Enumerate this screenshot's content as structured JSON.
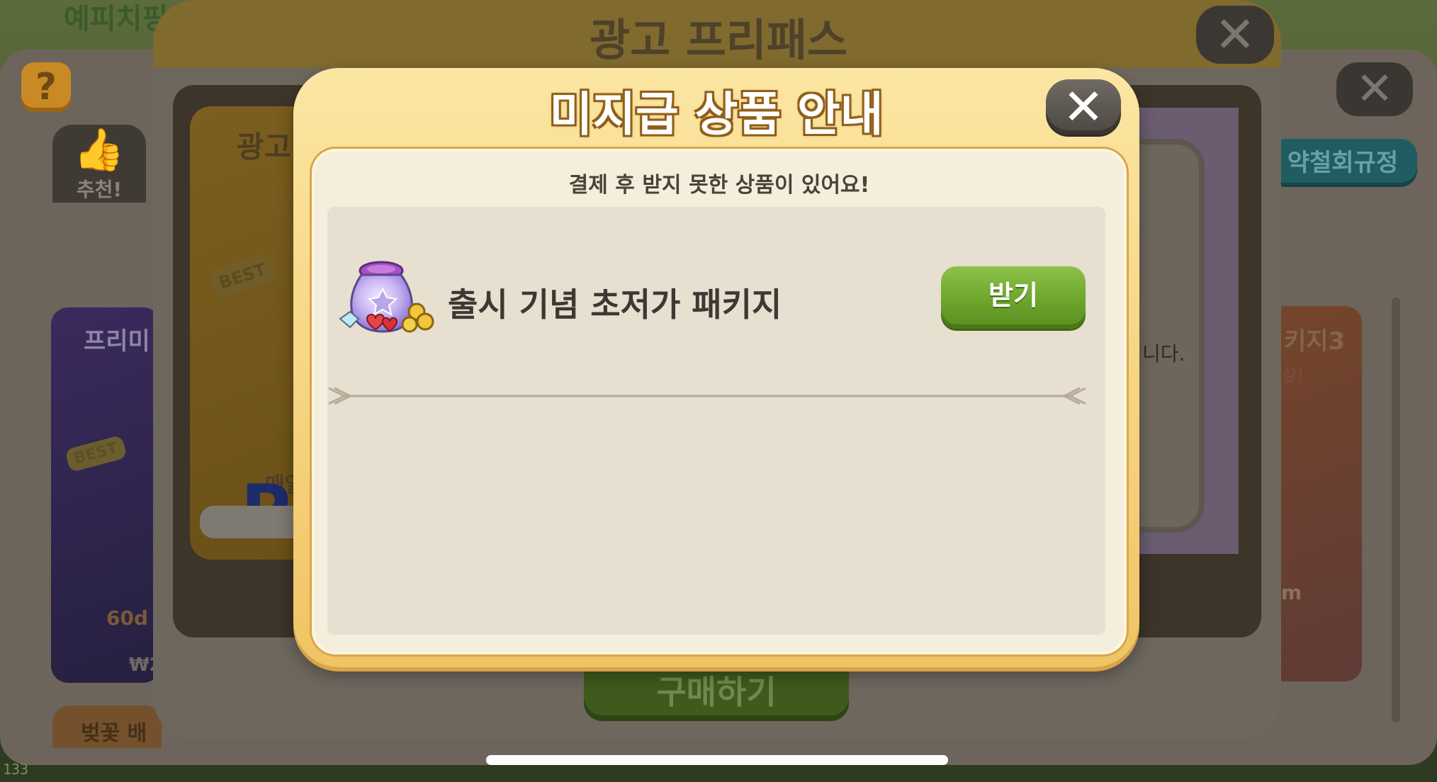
{
  "background": {
    "top_left_text": "예피치핑",
    "help_label": "?",
    "close_label": "✕",
    "tab_recommend": "추천!",
    "policy_button": "약철회규정",
    "left_card": {
      "title": "프리미",
      "badge": "BEST",
      "days": "60d",
      "price": "₩2"
    },
    "bottom_card": "벚꽃 배",
    "right_card": {
      "title": "키지3",
      "sub": "상!",
      "m": "m"
    },
    "corner_number": "133"
  },
  "mid_modal": {
    "title": "광고 프리패스",
    "close_label": "✕",
    "left_card": {
      "title": "광고",
      "badge": "BEST",
      "p": "P",
      "mae": "매일"
    },
    "right_text": "니다.",
    "buy_button": "구매하기"
  },
  "dialog": {
    "title": "미지급 상품 안내",
    "close_label": "✕",
    "subtitle": "결제 후 받지 못한 상품이 있어요!",
    "items": [
      {
        "name": "출시 기념 초저가 패키지",
        "icon": "pouch-hearts-coins-icon",
        "button_label": "받기"
      }
    ]
  },
  "colors": {
    "dialog_bg": "#f6d27e",
    "button_green": "#6aa22a",
    "list_bg": "#e7dfd0"
  }
}
